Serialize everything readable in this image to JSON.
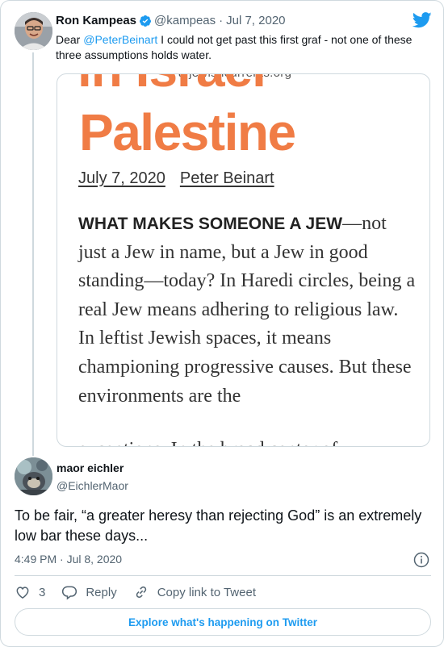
{
  "parent_tweet": {
    "name": "Ron Kampeas",
    "handle": "@kampeas",
    "separator": "·",
    "date": "Jul 7, 2020",
    "text_before": "Dear ",
    "mention": "@PeterBeinart",
    "text_after": " I could not get past this first graf - not one of these three assumptions holds water."
  },
  "media": {
    "top_url": "a jewishcurrents.org",
    "heading_cut": "in Israel",
    "heading": "Palestine",
    "date": "July 7, 2020",
    "author": "Peter Beinart",
    "lead": "WHAT MAKES SOMEONE A JEW",
    "body": "—not just a Jew in name, but a Jew in good standing—today? In Haredi circles, being a real Jew means adhering to religious law. In leftist Jewish spaces, it means championing progressive causes. But these environments are the",
    "cutoff": "exceptions. In the broad center of"
  },
  "reply_tweet": {
    "name": "maor eichler",
    "handle": "@EichlerMaor",
    "text": "To be fair, “a greater heresy than rejecting God” is an extremely low bar these days...",
    "time": "4:49 PM · Jul 8, 2020",
    "like_count": "3",
    "reply_label": "Reply",
    "copy_link_label": "Copy link to Tweet",
    "explore_label": "Explore what's happening on Twitter"
  },
  "icons": {
    "verified": "verified-badge-icon",
    "bird": "twitter-bird-icon",
    "info": "info-icon",
    "like": "heart-icon",
    "reply": "reply-icon",
    "link": "link-icon"
  },
  "colors": {
    "accent": "#1d9bf0",
    "headline": "#f07c45",
    "muted": "#536471",
    "border": "#cfd9de"
  }
}
